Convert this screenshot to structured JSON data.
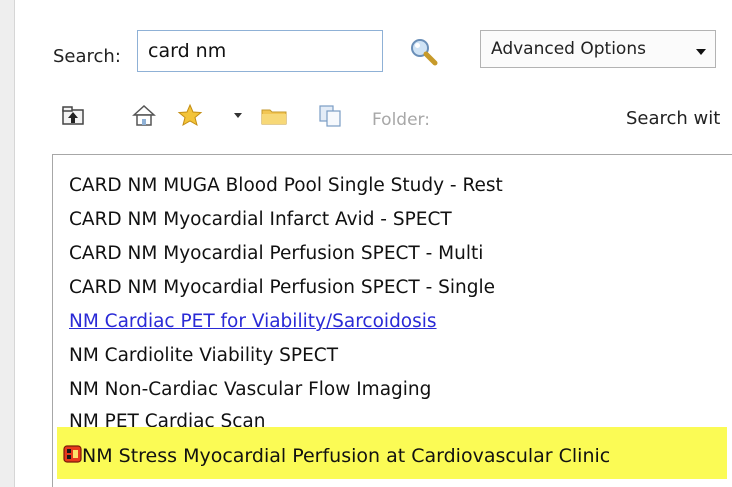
{
  "search": {
    "label": "Search:",
    "value": "card nm"
  },
  "advanced": {
    "label": "Advanced Options"
  },
  "toolbar": {
    "folder_label": "Folder:",
    "search_within": "Search wit"
  },
  "results": [
    {
      "label": "CARD NM MUGA Blood Pool Single Study - Rest"
    },
    {
      "label": "CARD NM Myocardial Infarct Avid - SPECT"
    },
    {
      "label": "CARD NM Myocardial Perfusion SPECT - Multi"
    },
    {
      "label": "CARD NM Myocardial Perfusion SPECT - Single"
    },
    {
      "label": "NM Cardiac PET for Viability/Sarcoidosis"
    },
    {
      "label": "NM Cardiolite Viability SPECT"
    },
    {
      "label": "NM Non-Cardiac Vascular Flow Imaging"
    },
    {
      "label": "NM PET Cardiac Scan"
    },
    {
      "label": "NM Stress Myocardial Perfusion at Cardiovascular Clinic"
    }
  ],
  "colors": {
    "highlight": "#fbfb55",
    "link": "#2a2ad6",
    "input_border": "#8fb1d6"
  }
}
